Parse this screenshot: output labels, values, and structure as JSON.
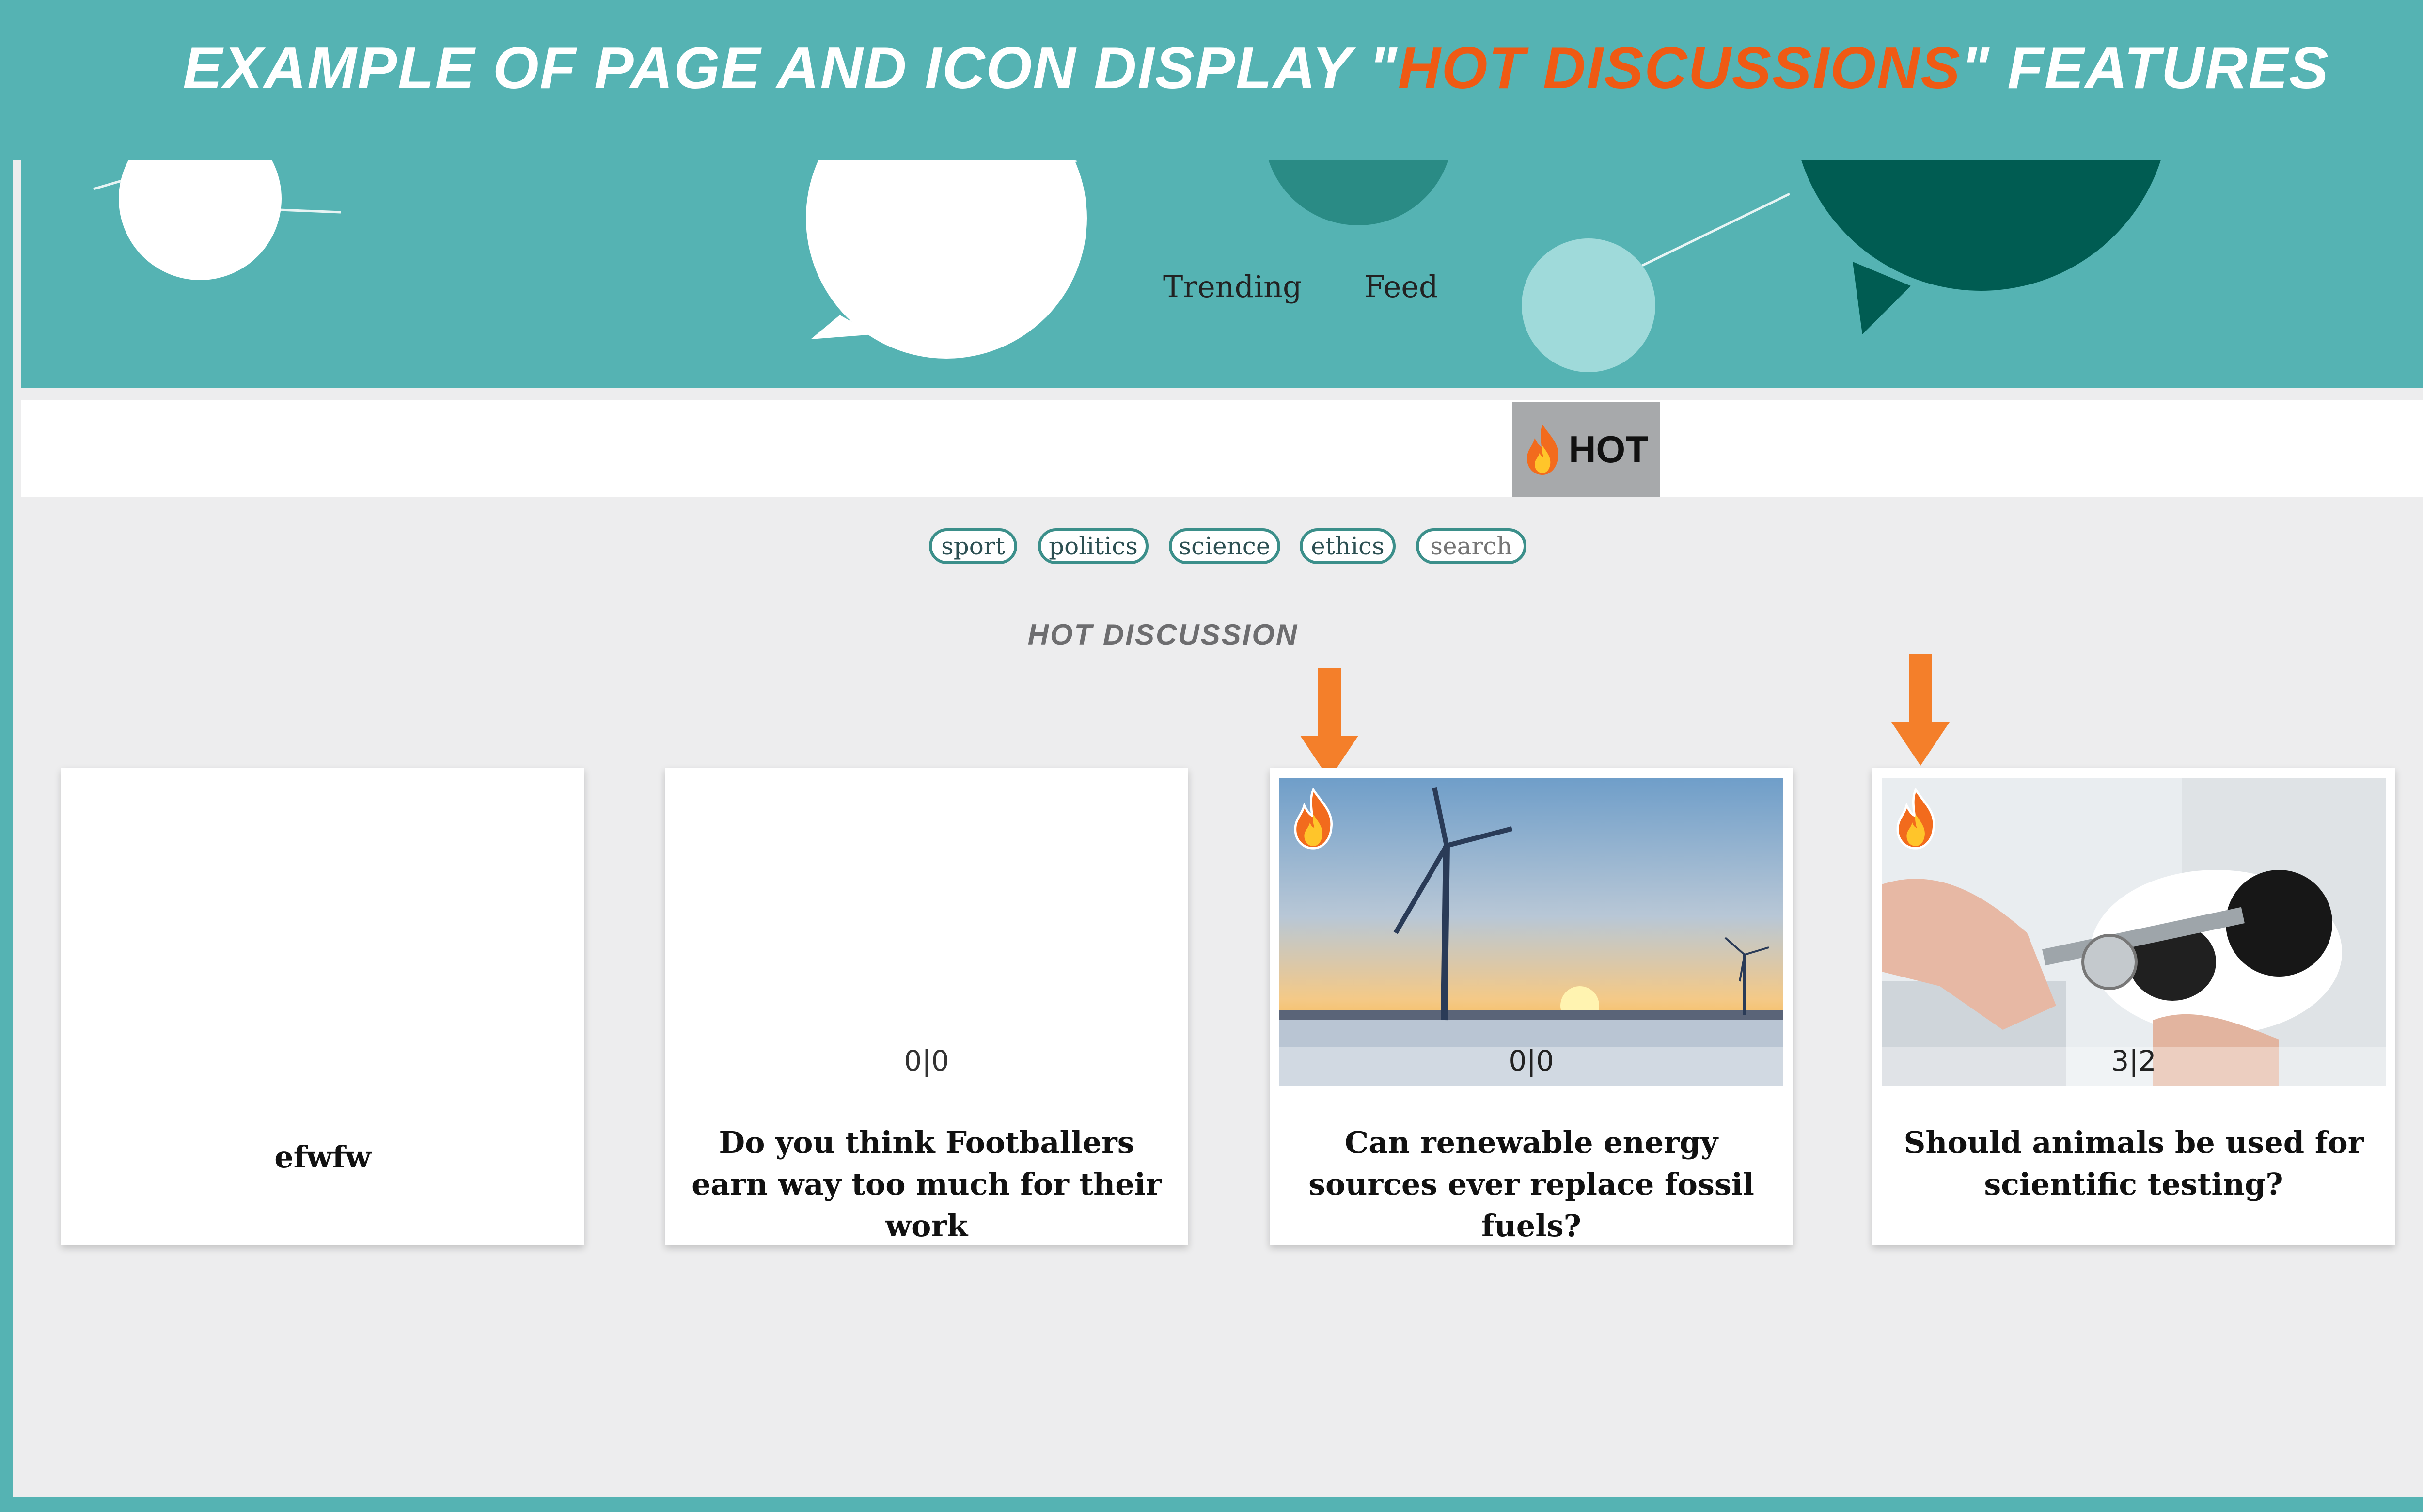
{
  "header": {
    "title_prefix": "EXAMPLE OF PAGE AND ICON DISPLAY \"",
    "title_highlight": "HOT DISCUSSIONS",
    "title_suffix": "\" FEATURES"
  },
  "nav": {
    "items": [
      {
        "label": "Trending"
      },
      {
        "label": "Feed"
      }
    ],
    "hot_label": "HOT",
    "hot_icon": "flame-icon"
  },
  "tags": [
    "sport",
    "politics",
    "science",
    "ethics"
  ],
  "search": {
    "placeholder": "search"
  },
  "section_label": "HOT DISCUSSION",
  "cards": [
    {
      "count": "",
      "title": "efwfw",
      "hot": false
    },
    {
      "count": "0|0",
      "title": "Do you think Footballers earn way too much for their work",
      "hot": false
    },
    {
      "count": "0|0",
      "title": "Can renewable energy sources ever replace fossil fuels?",
      "hot": true,
      "image": "wind-turbine-sunset"
    },
    {
      "count": "3|2",
      "title": "Should animals be used for scientific testing?",
      "hot": true,
      "image": "guinea-pig-lab"
    }
  ],
  "colors": {
    "brand_teal": "#55b3b3",
    "dark_teal": "#005c52",
    "highlight_orange": "#ef5a14",
    "arrow_orange": "#f47f2a",
    "hot_tab_bg": "#a7a9ab",
    "page_bg": "#ededee"
  }
}
